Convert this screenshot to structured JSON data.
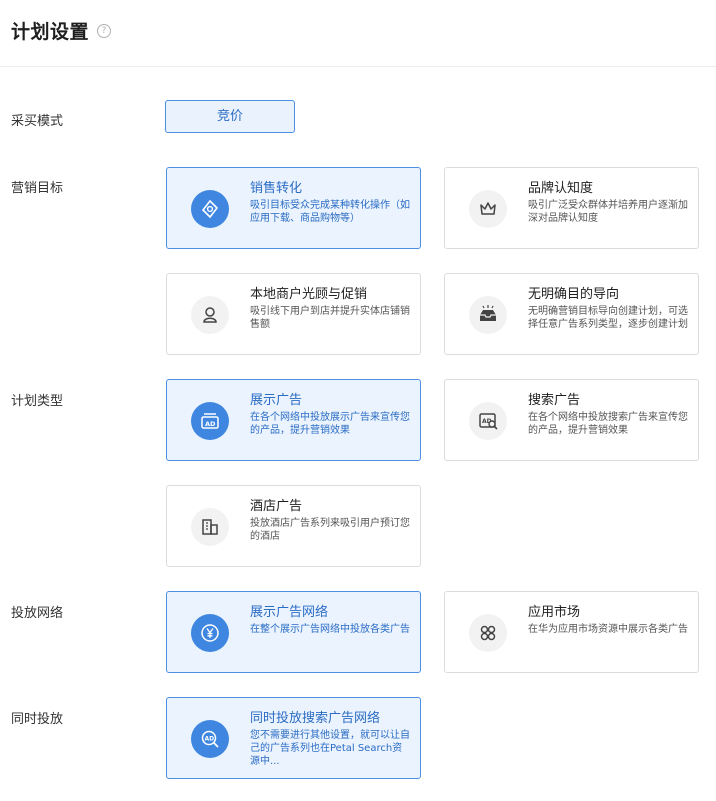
{
  "header": {
    "title": "计划设置",
    "help_icon": "question-circle-icon"
  },
  "purchase_mode": {
    "label": "采买模式",
    "option": "竞价"
  },
  "marketing_goal": {
    "label": "营销目标",
    "options": [
      {
        "title": "销售转化",
        "desc": "吸引目标受众完成某种转化操作（如应用下载、商品购物等）",
        "icon": "conversion-icon",
        "selected": true
      },
      {
        "title": "品牌认知度",
        "desc": "吸引广泛受众群体并培养用户逐渐加深对品牌认知度",
        "icon": "crown-icon",
        "selected": false
      },
      {
        "title": "本地商户光顾与促销",
        "desc": "吸引线下用户到店并提升实体店铺销售额",
        "icon": "location-icon",
        "selected": false
      },
      {
        "title": "无明确目的导向",
        "desc": "无明确营销目标导向创建计划，可选择任意广告系列类型，逐步创建计划",
        "icon": "inbox-icon",
        "selected": false
      }
    ]
  },
  "plan_type": {
    "label": "计划类型",
    "options": [
      {
        "title": "展示广告",
        "desc": "在各个网络中投放展示广告来宣传您的产品，提升营销效果",
        "icon": "display-ad-icon",
        "selected": true
      },
      {
        "title": "搜索广告",
        "desc": "在各个网络中投放搜索广告来宣传您的产品，提升营销效果",
        "icon": "search-ad-icon",
        "selected": false
      },
      {
        "title": "酒店广告",
        "desc": "投放酒店广告系列来吸引用户预订您的酒店",
        "icon": "hotel-icon",
        "selected": false
      }
    ]
  },
  "network": {
    "label": "投放网络",
    "options": [
      {
        "title": "展示广告网络",
        "desc": "在整个展示广告网络中投放各类广告",
        "icon": "yuan-icon",
        "selected": true
      },
      {
        "title": "应用市场",
        "desc": "在华为应用市场资源中展示各类广告",
        "icon": "app-grid-icon",
        "selected": false
      }
    ]
  },
  "simultaneous": {
    "label": "同时投放",
    "options": [
      {
        "title": "同时投放搜索广告网络",
        "desc": "您不需要进行其他设置，就可以让自己的广告系列也在Petal Search资源中...",
        "icon": "ad-search-icon",
        "selected": true
      }
    ]
  },
  "colors": {
    "accent": "#3e86e0",
    "selected_bg": "#eaf3fe",
    "selected_border": "#4a8fe0"
  }
}
